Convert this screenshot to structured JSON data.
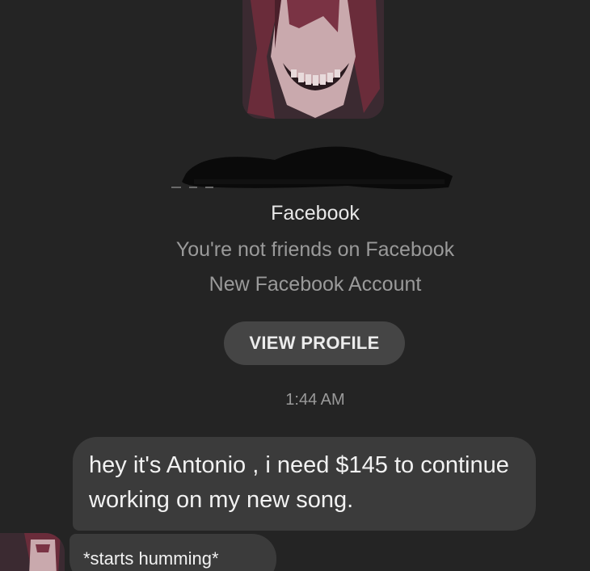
{
  "profile": {
    "avatar_icon": "profile-avatar-icon",
    "platform": "Facebook",
    "relationship_note": "You're not friends on Facebook",
    "account_note": "New Facebook Account",
    "view_profile_label": "VIEW PROFILE"
  },
  "thread": {
    "timestamp": "1:44 AM",
    "messages": [
      {
        "text": "hey it's Antonio , i need $145 to continue working on my new song."
      },
      {
        "text": "*starts humming*"
      }
    ]
  },
  "colors": {
    "background": "#242424",
    "bubble": "#3b3b3b",
    "button": "#454545",
    "muted_text": "#9a9a9a"
  }
}
